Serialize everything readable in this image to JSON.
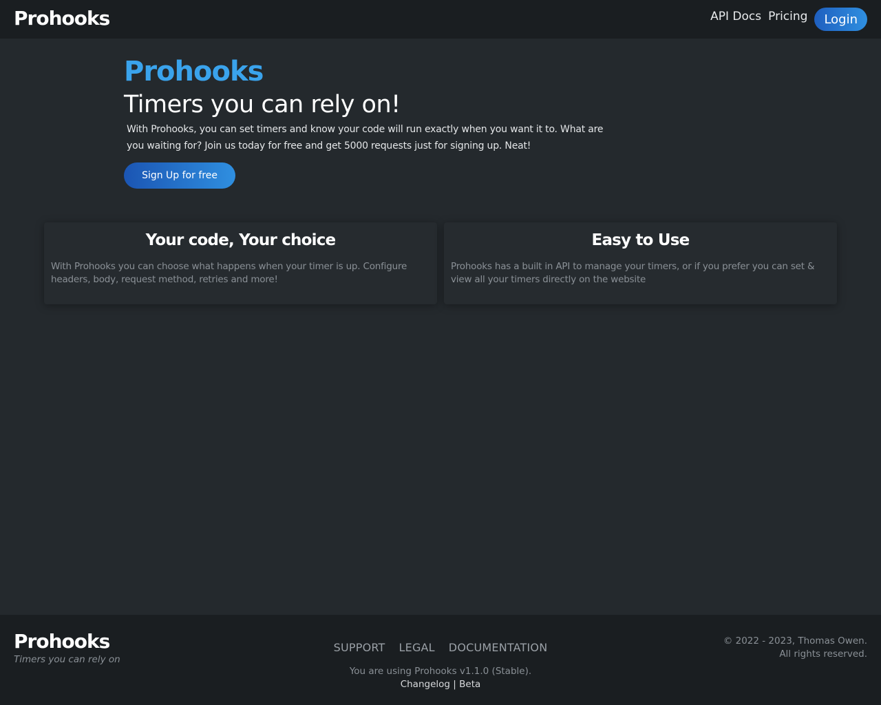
{
  "header": {
    "brand": "Prohooks",
    "nav": {
      "api_docs": "API Docs",
      "pricing": "Pricing",
      "login": "Login"
    }
  },
  "hero": {
    "brand": "Prohooks",
    "title": "Timers you can rely on!",
    "description": "With Prohooks, you can set timers and know your code will run exactly when you want it to. What are you waiting for? Join us today for free and get 5000 requests just for signing up. Neat!",
    "cta_label": "Sign Up for free"
  },
  "features": [
    {
      "title": "Your code, Your choice",
      "text": "With Prohooks you can choose what happens when your timer is up. Configure headers, body, request method, retries and more!"
    },
    {
      "title": "Easy to Use",
      "text": "Prohooks has a built in API to manage your timers, or if you prefer you can set & view all your timers directly on the website"
    }
  ],
  "footer": {
    "brand": "Prohooks",
    "tagline": "Timers you can rely on",
    "links": {
      "support": "SUPPORT",
      "legal": "LEGAL",
      "documentation": "DOCUMENTATION"
    },
    "version_text": "You are using Prohooks v1.1.0 (Stable).",
    "changelog": "Changelog",
    "separator": "|",
    "beta": "Beta",
    "copyright_line1": "© 2022 - 2023, Thomas Owen.",
    "copyright_line2": "All rights reserved."
  },
  "colors": {
    "background": "#24292d",
    "navbar": "#1a1e21",
    "accent": "#3aa3ec",
    "button_start": "#1f5fbf",
    "button_end": "#2f8fe0"
  }
}
